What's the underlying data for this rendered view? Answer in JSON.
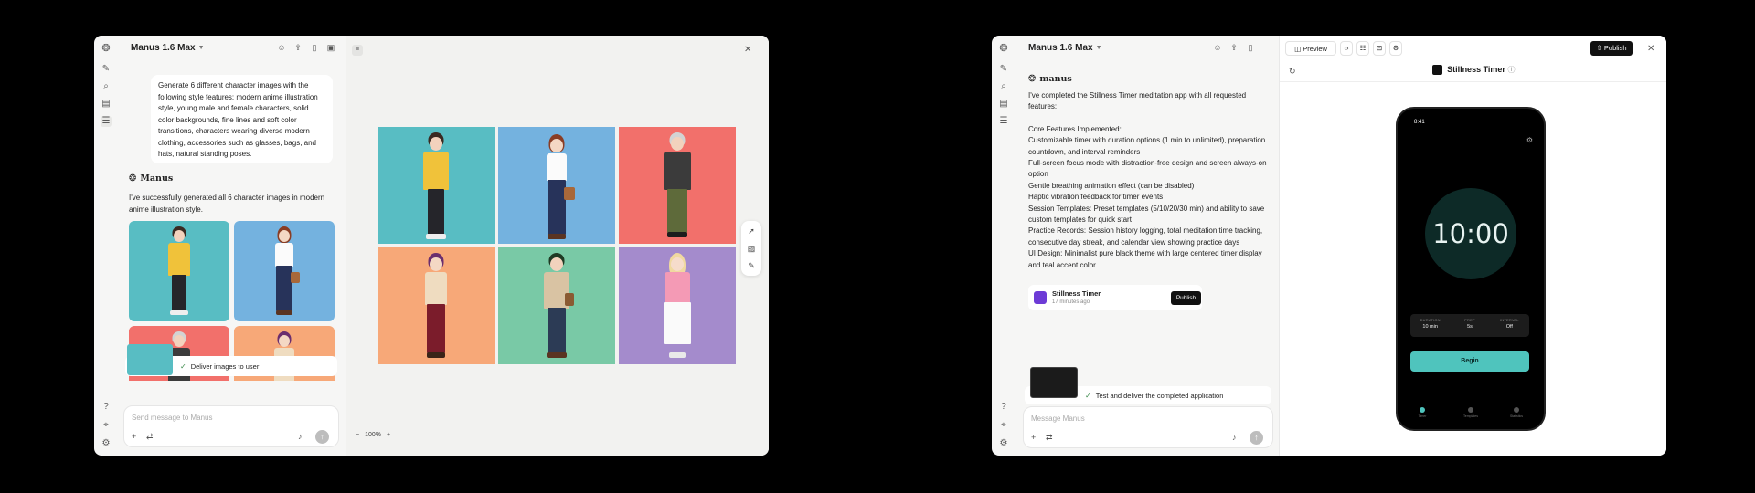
{
  "window1": {
    "title": "Manus 1.6 Max",
    "rail_icons": [
      "manus-logo-icon",
      "new-task-icon",
      "search-icon",
      "library-icon",
      "tasks-icon",
      "help-icon",
      "location-icon",
      "settings-icon"
    ],
    "user_prompt": "Generate 6 different character images with the following style features: modern anime illustration style, young male and female characters, solid color backgrounds, fine lines and soft color transitions, characters wearing diverse modern clothing, accessories such as glasses, bags, and hats, natural standing poses.",
    "brand": "Manus",
    "reply": "I've successfully generated all 6 character images in modern anime illustration style.",
    "status_step": "Deliver images to user",
    "input_placeholder": "Send message to Manus",
    "zoom": "100%",
    "tile_colors": [
      "#58bdc3",
      "#74b2df",
      "#f2706b",
      "#f7a878",
      "#79c9a6",
      "#a48bcc"
    ]
  },
  "window2": {
    "title": "Manus 1.6 Max",
    "preview_label": "Preview",
    "publish_label": "Publish",
    "brand": "manus",
    "intro": "I've completed the Stillness Timer meditation app with all requested features:",
    "features_heading": "Core Features Implemented:",
    "features": [
      "Customizable timer with duration options (1 min to unlimited), preparation countdown, and interval reminders",
      "Full-screen focus mode with distraction-free design and screen always-on option",
      "Gentle breathing animation effect (can be disabled)",
      "Haptic vibration feedback for timer events",
      "Session Templates: Preset templates (5/10/20/30 min) and ability to save custom templates for quick start",
      "Practice Records: Session history logging, total meditation time tracking, consecutive day streak, and calendar view showing practice days",
      "UI Design: Minimalist pure black theme with large centered timer display and teal accent color"
    ],
    "card": {
      "name": "Stillness Timer",
      "time": "17 minutes ago",
      "button": "Publish"
    },
    "status_step": "Test and deliver the completed application",
    "input_placeholder": "Message Manus",
    "app_title": "Stillness Timer",
    "phone": {
      "clock": "8:41",
      "timer": "10:00",
      "settings": [
        {
          "key": "DURATION",
          "value": "10 min"
        },
        {
          "key": "PREP",
          "value": "5s"
        },
        {
          "key": "INTERVAL",
          "value": "Off"
        }
      ],
      "begin": "Begin",
      "nav": [
        "Timer",
        "Templates",
        "Statistics"
      ]
    },
    "accent": "#4fc4bd"
  }
}
